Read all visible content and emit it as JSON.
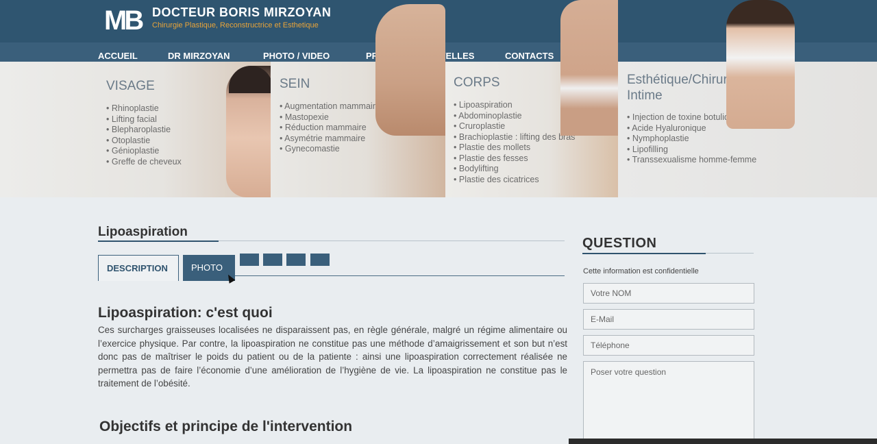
{
  "header": {
    "logo": "MB",
    "brand_name": "DOCTEUR BORIS MIRZOYAN",
    "brand_tagline": "Chirurgie Plastique, Reconstructrice et Esthetique",
    "language": "FR"
  },
  "nav": {
    "items": [
      {
        "label": "ACCUEIL"
      },
      {
        "label": "DR MIRZOYAN"
      },
      {
        "label": "PHOTO / VIDEO"
      },
      {
        "label": "PRIX"
      },
      {
        "label": "NOUVELLES"
      },
      {
        "label": "CONTACTS"
      }
    ]
  },
  "banner": {
    "panels": [
      {
        "title": "VISAGE",
        "items": [
          "Rhinoplastie",
          "Lifting facial",
          "Blepharoplastie",
          "Otoplastie",
          "Génioplastie",
          "Greffe de cheveux"
        ]
      },
      {
        "title": "SEIN",
        "items": [
          "Augmentation mammaire",
          "Mastopexie",
          "Réduction mammaire",
          "Asymétrie mammaire",
          "Gynecomastie"
        ]
      },
      {
        "title": "CORPS",
        "items": [
          "Lipoaspiration",
          "Abdominoplastie",
          "Cruroplastie",
          "Brachioplastie : lifting des bras",
          "Plastie des mollets",
          "Plastie des fesses",
          "Bodylifting",
          "Plastie des cicatrices"
        ]
      },
      {
        "title": "Esthétique/Chirurgie Intime",
        "items": [
          "Injection de toxine botulique",
          "Acide Hyaluronique",
          "Nymphoplastie",
          "Lipofilling",
          "Transsexualisme homme-femme"
        ]
      }
    ]
  },
  "main": {
    "page_title": "Lipoaspiration",
    "tabs": [
      {
        "label": "DESCRIPTION"
      },
      {
        "label": "PHOTO"
      }
    ],
    "section1_title": "Lipoaspiration: c'est quoi",
    "section1_text": "Ces surcharges graisseuses localisées ne disparaissent pas, en règle générale, malgré un régime alimentaire ou l’exercice physique. Par contre, la lipoaspiration ne constitue pas une méthode d’amaigrissement et son but n’est donc pas de maîtriser le poids du patient ou de la patiente : ainsi une lipoaspiration correctement réalisée ne permettra pas de faire l’économie d’une amélioration de l’hygiène de vie. La lipoaspiration ne constitue pas le traitement de l’obésité.",
    "section2_title": "Objectifs et principe de l'intervention"
  },
  "question_form": {
    "title": "QUESTION",
    "note": "Cette information est confidentielle",
    "name_placeholder": "Votre NOM",
    "email_placeholder": "E-Mail",
    "phone_placeholder": "Téléphone",
    "question_placeholder": "Poser votre question"
  }
}
